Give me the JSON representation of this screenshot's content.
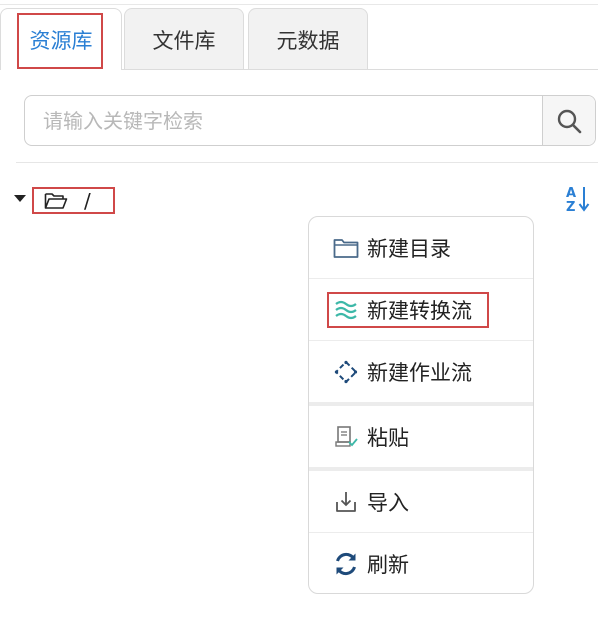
{
  "tabs": [
    {
      "label": "资源库",
      "active": true
    },
    {
      "label": "文件库",
      "active": false
    },
    {
      "label": "元数据",
      "active": false
    }
  ],
  "search": {
    "placeholder": "请输入关键字检索",
    "icon": "search-icon"
  },
  "tree": {
    "root_label": "/",
    "root_icon": "folder-open-icon",
    "sort_icon": "sort-az-icon"
  },
  "context_menu": {
    "items": [
      {
        "label": "新建目录",
        "icon": "folder-icon"
      },
      {
        "label": "新建转换流",
        "icon": "transform-flow-icon"
      },
      {
        "label": "新建作业流",
        "icon": "job-flow-icon"
      },
      {
        "label": "粘贴",
        "icon": "paste-icon"
      },
      {
        "label": "导入",
        "icon": "import-icon"
      },
      {
        "label": "刷新",
        "icon": "refresh-icon"
      }
    ]
  },
  "colors": {
    "accent": "#2a7fd4",
    "highlight_border": "#d04848",
    "transform_icon": "#3db8a8",
    "sort_icon": "#2a7fd4"
  }
}
